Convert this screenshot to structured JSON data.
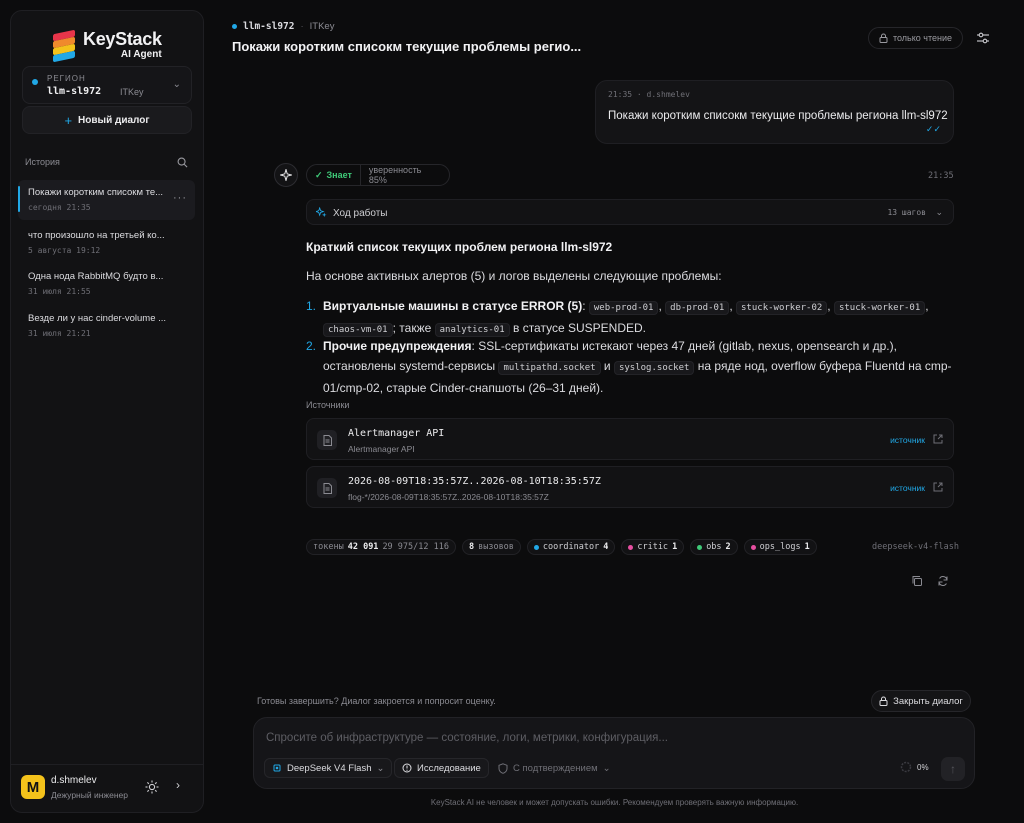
{
  "brand": {
    "title": "KeyStack",
    "subtitle": "AI Agent"
  },
  "sidebar": {
    "region": {
      "label": "РЕГИОН",
      "value": "llm-sl972",
      "tenant": "ITKey"
    },
    "new_dialog": "Новый диалог",
    "history_label": "История",
    "history": [
      {
        "title": "Покажи коротким списокм те...",
        "date": "сегодня 21:35"
      },
      {
        "title": "что произошло на третьей ко...",
        "date": "5 августа 19:12"
      },
      {
        "title": "Одна нода RabbitMQ будто в...",
        "date": "31 июля 21:55"
      },
      {
        "title": "Везде ли у нас cinder-volume ...",
        "date": "31 июля 21:21"
      }
    ],
    "user": {
      "initial": "M",
      "name": "d.shmelev",
      "role": "Дежурный инженер"
    }
  },
  "header": {
    "region": "llm-sl972",
    "tenant": "ITKey",
    "title": "Покажи коротким списокм текущие проблемы регио...",
    "readonly": "только чтение"
  },
  "user_message": {
    "time": "21:35",
    "author": "d.shmelev",
    "text": "Покажи коротким списокм текущие проблемы региона llm-sl972"
  },
  "assistant": {
    "knows": "Знает",
    "confidence": "уверенность 85%",
    "time": "21:35",
    "progress_label": "Ход работы",
    "steps": "13 шагов",
    "heading": "Краткий список текущих проблем региона llm-sl972",
    "intro": "На основе активных алертов (5) и логов выделены следующие проблемы:",
    "item1": {
      "num": "1.",
      "bold": "Виртуальные машины в статусе ERROR (5)",
      "vms": [
        "web-prod-01",
        "db-prod-01",
        "stuck-worker-02",
        "stuck-worker-01",
        "chaos-vm-01"
      ],
      "also": "; также",
      "extra_vm": "analytics-01",
      "tail": "в статусе SUSPENDED."
    },
    "item2": {
      "num": "2.",
      "bold": "Прочие предупреждения",
      "text1": ": SSL-сертификаты истекают через 47 дней (gitlab, nexus, opensearch и др.), остановлены systemd-сервисы",
      "svc1": "multipathd.socket",
      "and": "и",
      "svc2": "syslog.socket",
      "text2": "на ряде нод, overflow буфера Fluentd на cmp-01/cmp-02, старые Cinder-снапшоты (26–31 дней)."
    },
    "sources_label": "Источники",
    "sources": [
      {
        "title": "Alertmanager API",
        "sub": "Alertmanager API",
        "link": "источник"
      },
      {
        "title": "2026-08-09T18:35:57Z..2026-08-10T18:35:57Z",
        "sub": "flog-*/2026-08-09T18:35:57Z..2026-08-10T18:35:57Z",
        "link": "источник"
      }
    ],
    "stats": {
      "tokens_label": "токены",
      "tokens": "42 091",
      "tokens_split": "29 975/12 116",
      "calls": "8",
      "calls_label": "вызовов",
      "agents": [
        {
          "name": "coordinator",
          "count": "4",
          "color": "#21a8e6"
        },
        {
          "name": "critic",
          "count": "1",
          "color": "#e64ea0"
        },
        {
          "name": "obs",
          "count": "2",
          "color": "#3fc978"
        },
        {
          "name": "ops_logs",
          "count": "1",
          "color": "#e64ea0"
        }
      ]
    },
    "model": "deepseek-v4-flash"
  },
  "composer": {
    "ready_text": "Готовы завершить? Диалог закроется и попросит оценку.",
    "close_label": "Закрыть диалог",
    "placeholder": "Спросите об инфраструктуре — состояние, логи, метрики, конфигурация...",
    "model": "DeepSeek V4 Flash",
    "research": "Исследование",
    "confirm": "С подтверждением",
    "context": "0%"
  },
  "disclaimer": "KeyStack AI не человек и может допускать ошибки. Рекомендуем проверять важную информацию.",
  "colors": {
    "accent": "#21a8e6",
    "success": "#3fc978",
    "avatar": "#f4c21b"
  }
}
